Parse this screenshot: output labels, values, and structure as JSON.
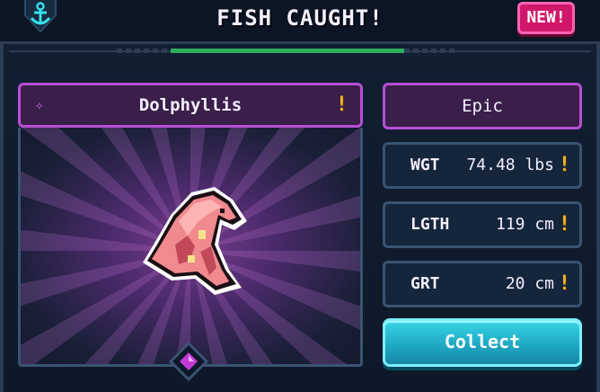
{
  "header": {
    "title": "FISH CAUGHT!",
    "badge": "NEW!"
  },
  "fish": {
    "name": "Dolphyllis",
    "rarity": "Epic",
    "alert": "!"
  },
  "stats": [
    {
      "label": "WGT",
      "value": "74.48 lbs",
      "alert": "!"
    },
    {
      "label": "LGTH",
      "value": "119 cm",
      "alert": "!"
    },
    {
      "label": "GRT",
      "value": "20 cm",
      "alert": "!"
    }
  ],
  "actions": {
    "collect": "Collect"
  },
  "colors": {
    "accent_purple": "#b64fd6",
    "accent_cyan": "#38d5e6",
    "badge_pink": "#d0186a",
    "warning": "#f2b52b"
  },
  "icons": {
    "header": "anchor-icon",
    "name_gem": "gem-icon",
    "bottom": "diamond-gem-icon"
  }
}
